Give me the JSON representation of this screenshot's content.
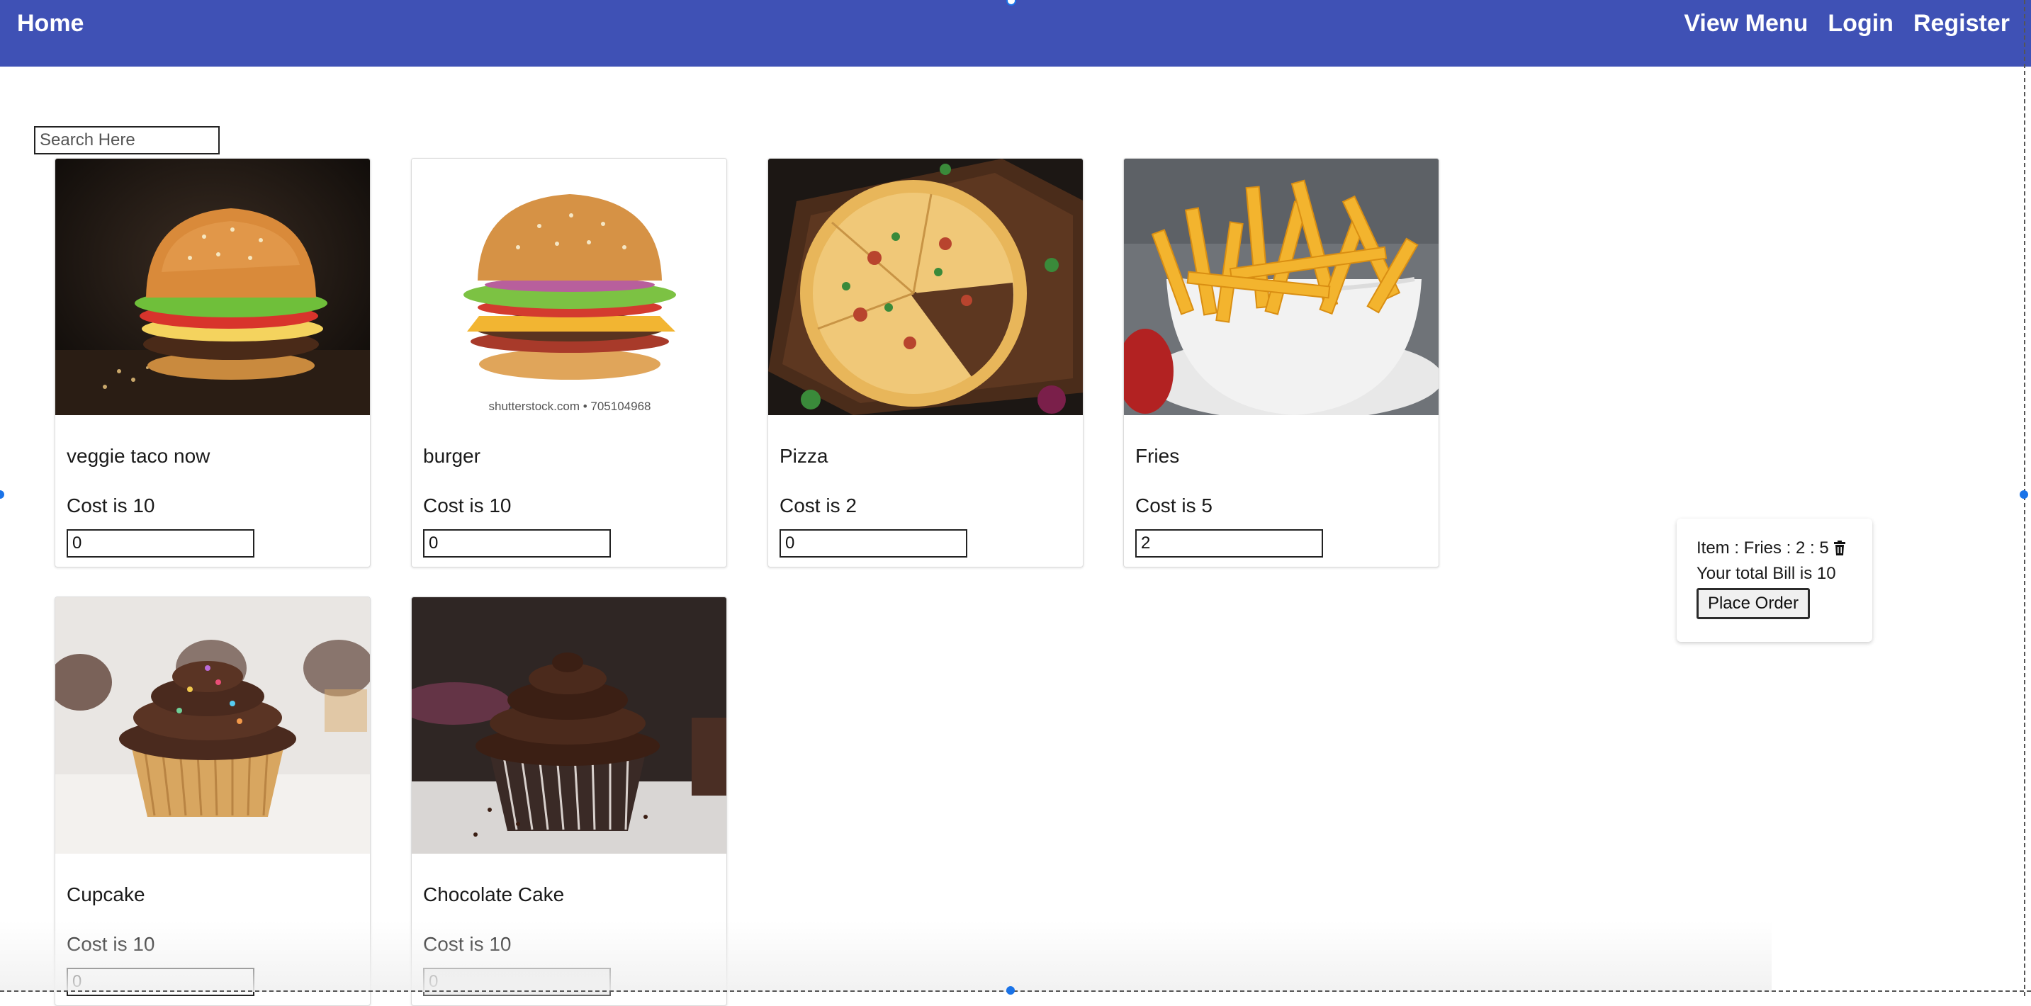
{
  "navbar": {
    "home": "Home",
    "links": [
      "View Menu",
      "Login",
      "Register"
    ],
    "color": "#3f51b5"
  },
  "search": {
    "placeholder": "Search Here",
    "value": ""
  },
  "menu": [
    {
      "name": "veggie taco now",
      "cost_label": "Cost is 10",
      "quantity": "0",
      "image": "burger-photo-icon"
    },
    {
      "name": "burger",
      "cost_label": "Cost is 10",
      "quantity": "0",
      "image": "burger-photo-icon",
      "watermark": "shutterstock.com • 705104968"
    },
    {
      "name": "Pizza",
      "cost_label": "Cost is 2",
      "quantity": "0",
      "image": "pizza-photo-icon"
    },
    {
      "name": "Fries",
      "cost_label": "Cost is 5",
      "quantity": "2",
      "image": "fries-photo-icon"
    },
    {
      "name": "Cupcake",
      "cost_label": "Cost is 10",
      "quantity": "0",
      "image": "cupcake-photo-icon"
    },
    {
      "name": "Chocolate Cake",
      "cost_label": "Cost is 10",
      "quantity": "0",
      "image": "chocolate-cupcake-photo-icon"
    }
  ],
  "cart": {
    "item_text": "Item : Fries : 2 : 5",
    "total_text": "Your total Bill is 10",
    "place_order_label": "Place Order",
    "delete_icon": "trash-icon"
  }
}
